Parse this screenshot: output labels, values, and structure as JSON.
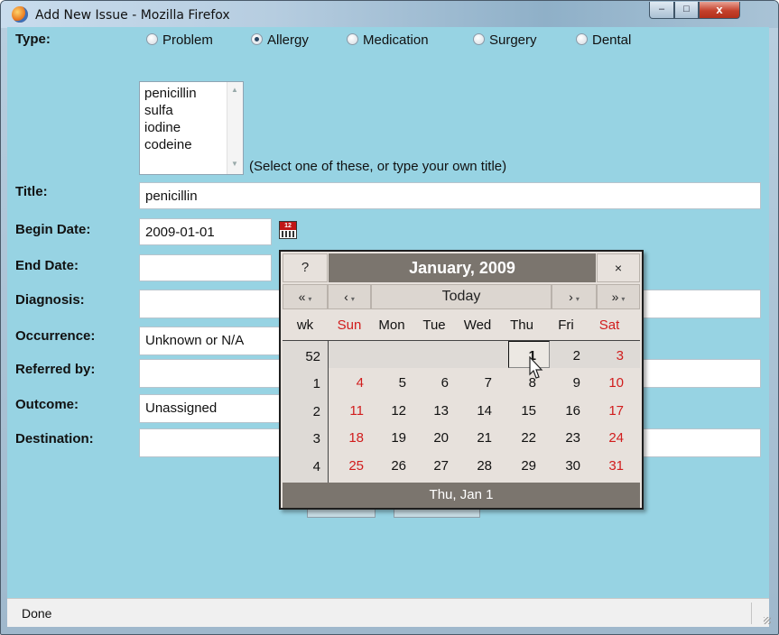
{
  "window": {
    "title": "Add New Issue - Mozilla Firefox",
    "controls": {
      "minimize": "–",
      "maximize": "□",
      "close": "x"
    }
  },
  "form": {
    "type_label": "Type:",
    "type_options": [
      "Problem",
      "Allergy",
      "Medication",
      "Surgery",
      "Dental"
    ],
    "type_selected": "Allergy",
    "title_choices": [
      "penicillin",
      "sulfa",
      "iodine",
      "codeine"
    ],
    "title_choices_hint": "(Select one of these, or type your own title)",
    "title_label": "Title:",
    "title_value": "penicillin",
    "begin_date_label": "Begin Date:",
    "begin_date_value": "2009-01-01",
    "end_date_label": "End Date:",
    "end_date_value": "",
    "diagnosis_label": "Diagnosis:",
    "diagnosis_value": "",
    "occurrence_label": "Occurrence:",
    "occurrence_value": "Unknown or N/A",
    "referred_by_label": "Referred by:",
    "referred_by_value": "",
    "outcome_label": "Outcome:",
    "outcome_value": "Unassigned",
    "destination_label": "Destination:",
    "destination_value": ""
  },
  "calendar": {
    "help": "?",
    "month_title": "January, 2009",
    "close": "×",
    "nav": {
      "prev_year": "«",
      "prev_month": "‹",
      "today": "Today",
      "next_month": "›",
      "next_year": "»"
    },
    "week_header": "wk",
    "day_headers": [
      "Sun",
      "Mon",
      "Tue",
      "Wed",
      "Thu",
      "Fri",
      "Sat"
    ],
    "weeks": [
      {
        "wk": "52",
        "days": [
          "",
          "",
          "",
          "",
          "1",
          "2",
          "3"
        ]
      },
      {
        "wk": "1",
        "days": [
          "4",
          "5",
          "6",
          "7",
          "8",
          "9",
          "10"
        ]
      },
      {
        "wk": "2",
        "days": [
          "11",
          "12",
          "13",
          "14",
          "15",
          "16",
          "17"
        ]
      },
      {
        "wk": "3",
        "days": [
          "18",
          "19",
          "20",
          "21",
          "22",
          "23",
          "24"
        ]
      },
      {
        "wk": "4",
        "days": [
          "25",
          "26",
          "27",
          "28",
          "29",
          "30",
          "31"
        ]
      }
    ],
    "selected_day": "1",
    "status": "Thu, Jan 1"
  },
  "statusbar": {
    "text": "Done"
  },
  "colors": {
    "client_bg": "#97d3e3",
    "weekend": "#d11c1c",
    "calendar_header": "#7b756e"
  }
}
